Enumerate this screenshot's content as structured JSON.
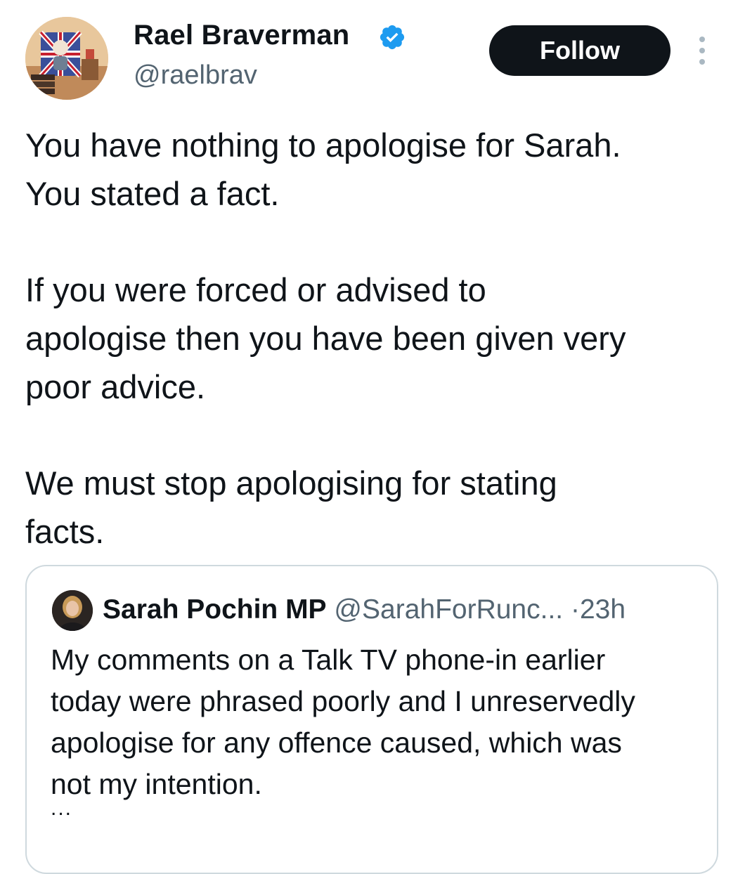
{
  "author": {
    "name": "Rael Braverman",
    "handle": "@raelbrav",
    "avatar_icon": "avatar-image",
    "verified_color": "#1d9bf0"
  },
  "actions": {
    "follow_label": "Follow",
    "more_icon": "more-vertical-icon"
  },
  "tweet": {
    "paragraphs": [
      [
        "You have nothing to apologise for Sarah.",
        "You stated a fact."
      ],
      [
        "If you were forced or advised to",
        "apologise then you have been given very",
        "poor advice."
      ],
      [
        "We must stop apologising for stating",
        "facts."
      ]
    ]
  },
  "quoted": {
    "name": "Sarah Pochin MP",
    "handle": "@SarahForRunc...",
    "separator": "·",
    "time": "23h",
    "text_lines": [
      "My comments on a Talk TV phone-in earlier",
      "today were phrased poorly and I unreservedly",
      "apologise for any offence caused, which was",
      "not my intention."
    ],
    "ellipsis": "..."
  },
  "colors": {
    "text": "#0f1419",
    "secondary": "#536471",
    "border": "#cfd9de",
    "button_bg": "#0f1419",
    "verified": "#1d9bf0"
  }
}
